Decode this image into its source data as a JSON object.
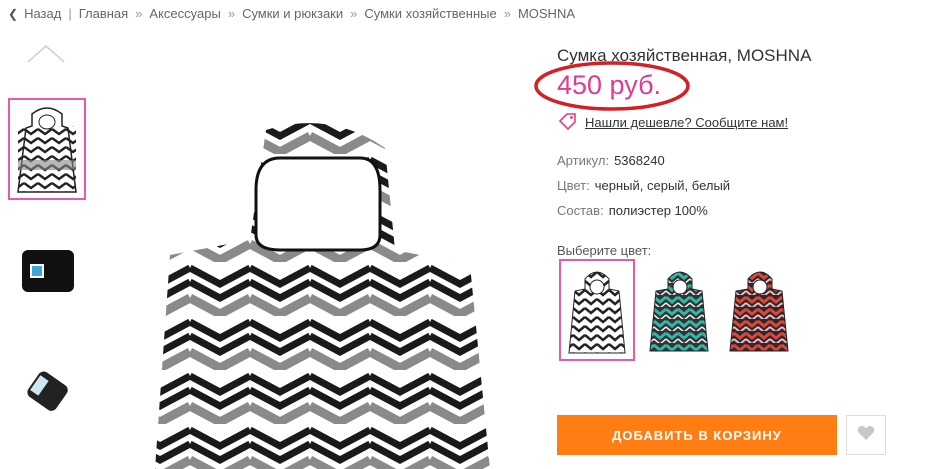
{
  "breadcrumb": {
    "back": "Назад",
    "items": [
      "Главная",
      "Аксессуары",
      "Сумки и рюкзаки",
      "Сумки хозяйственные",
      "MOSHNA"
    ]
  },
  "product": {
    "title": "Сумка хозяйственная, MOSHNA",
    "price": "450 руб.",
    "cheaper_link": "Нашли дешевле? Сообщите нам!",
    "attributes": [
      {
        "key": "Артикул:",
        "value": "5368240"
      },
      {
        "key": "Цвет:",
        "value": "черный, серый, белый"
      },
      {
        "key": "Состав:",
        "value": "полиэстер 100%"
      }
    ],
    "choose_color_label": "Выберите цвет:",
    "add_to_cart": "ДОБАВИТЬ В КОРЗИНУ"
  },
  "colors": {
    "accent": "#e23b8e",
    "button": "#ff7d12",
    "selection": "#e85aa6"
  },
  "icons": [
    "chevron-left-icon",
    "chevron-up-icon",
    "tag-icon",
    "heart-icon"
  ]
}
